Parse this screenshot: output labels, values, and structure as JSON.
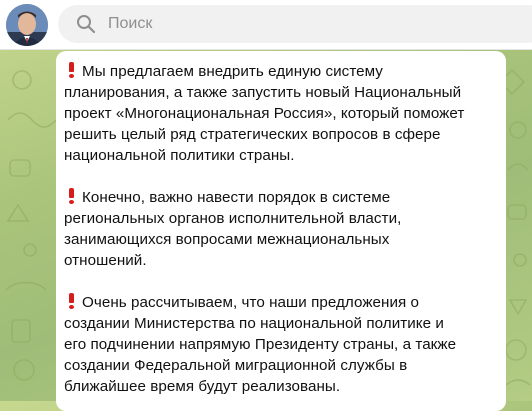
{
  "search": {
    "placeholder": "Поиск"
  },
  "icons": {
    "search": "search-icon",
    "bullet": "exclamation-icon",
    "avatar": "profile-photo"
  },
  "colors": {
    "bullet": "#d41d1d",
    "background": "#a9c47c"
  },
  "message": {
    "paragraphs": [
      {
        "lines": [
          "Мы предлагаем внедрить единую систему",
          "планирования, а также запустить новый Национальный",
          "проект «Многонациональная Россия», который поможет",
          "решить целый ряд стратегических вопросов в сфере",
          "национальной политики страны."
        ]
      },
      {
        "lines": [
          "Конечно, важно навести порядок в системе",
          "региональных органов исполнительной власти,",
          "занимающихся вопросами межнациональных",
          "отношений."
        ]
      },
      {
        "lines": [
          "Очень рассчитываем, что наши предложения о",
          "создании Министерства по национальной политике и",
          "его подчинении напрямую Президенту страны, а также",
          "создании Федеральной миграционной службы в",
          "ближайшее время будут реализованы."
        ]
      }
    ]
  }
}
